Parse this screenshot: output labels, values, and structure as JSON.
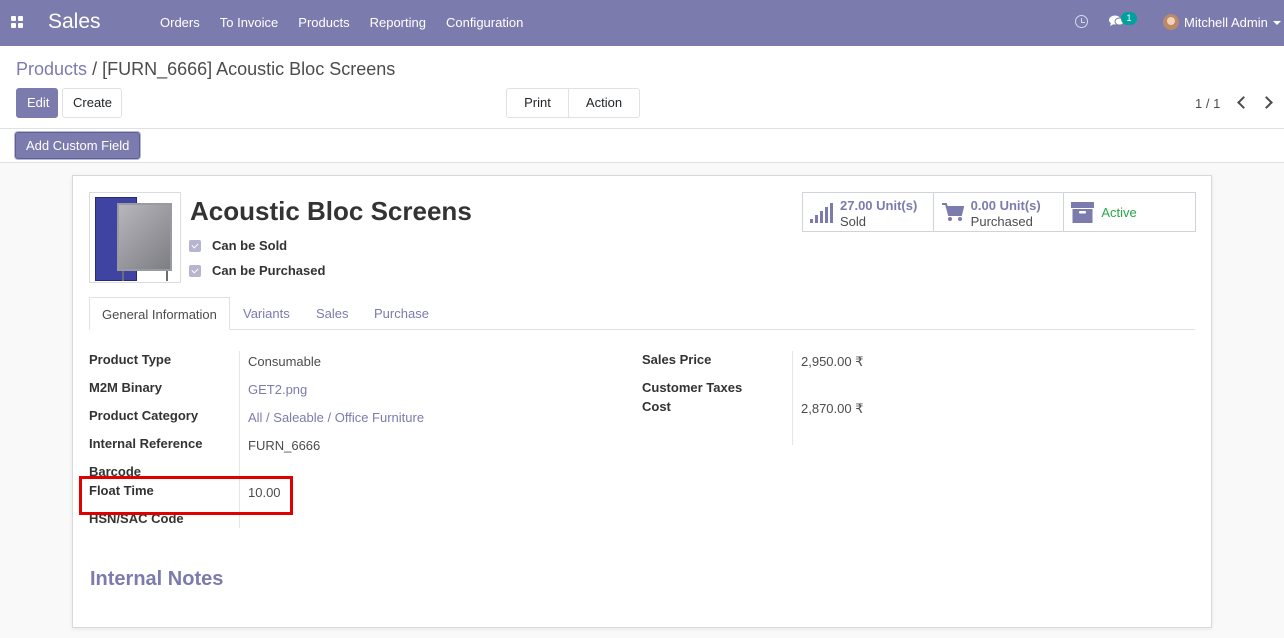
{
  "navbar": {
    "brand": "Sales",
    "menu": [
      "Orders",
      "To Invoice",
      "Products",
      "Reporting",
      "Configuration"
    ],
    "chat_count": "1",
    "user_name": "Mitchell Admin"
  },
  "breadcrumb": {
    "parent": "Products",
    "separator": "/",
    "current": "[FURN_6666] Acoustic Bloc Screens"
  },
  "toolbar": {
    "edit_label": "Edit",
    "create_label": "Create",
    "print_label": "Print",
    "action_label": "Action",
    "pager": "1 / 1",
    "custom_field_label": "Add Custom Field"
  },
  "product": {
    "name": "Acoustic Bloc Screens",
    "can_be_sold": "Can be Sold",
    "can_be_purchased": "Can be Purchased"
  },
  "smart_buttons": {
    "sold_value": "27.00 Unit(s)",
    "sold_label": "Sold",
    "purchased_value": "0.00 Unit(s)",
    "purchased_label": "Purchased",
    "active_label": "Active"
  },
  "tabs": [
    "General Information",
    "Variants",
    "Sales",
    "Purchase"
  ],
  "left_fields": [
    {
      "label": "Product Type",
      "value": "Consumable"
    },
    {
      "label": "M2M Binary",
      "value": "GET2.png"
    },
    {
      "label": "Product Category",
      "value": "All / Saleable / Office Furniture"
    },
    {
      "label": "Internal Reference",
      "value": "FURN_6666"
    },
    {
      "label": "Barcode",
      "value": ""
    },
    {
      "label": "Float Time",
      "value": "10.00"
    },
    {
      "label": "HSN/SAC Code",
      "value": ""
    }
  ],
  "right_fields": [
    {
      "label": "Sales Price",
      "value": "2,950.00 ₹"
    },
    {
      "label": "Customer Taxes",
      "value": ""
    },
    {
      "label": "Cost",
      "value": "2,870.00 ₹"
    }
  ],
  "notes_title": "Internal Notes",
  "colors": {
    "brand": "#7c7bad",
    "active": "#28a745",
    "highlight": "#e10000"
  }
}
